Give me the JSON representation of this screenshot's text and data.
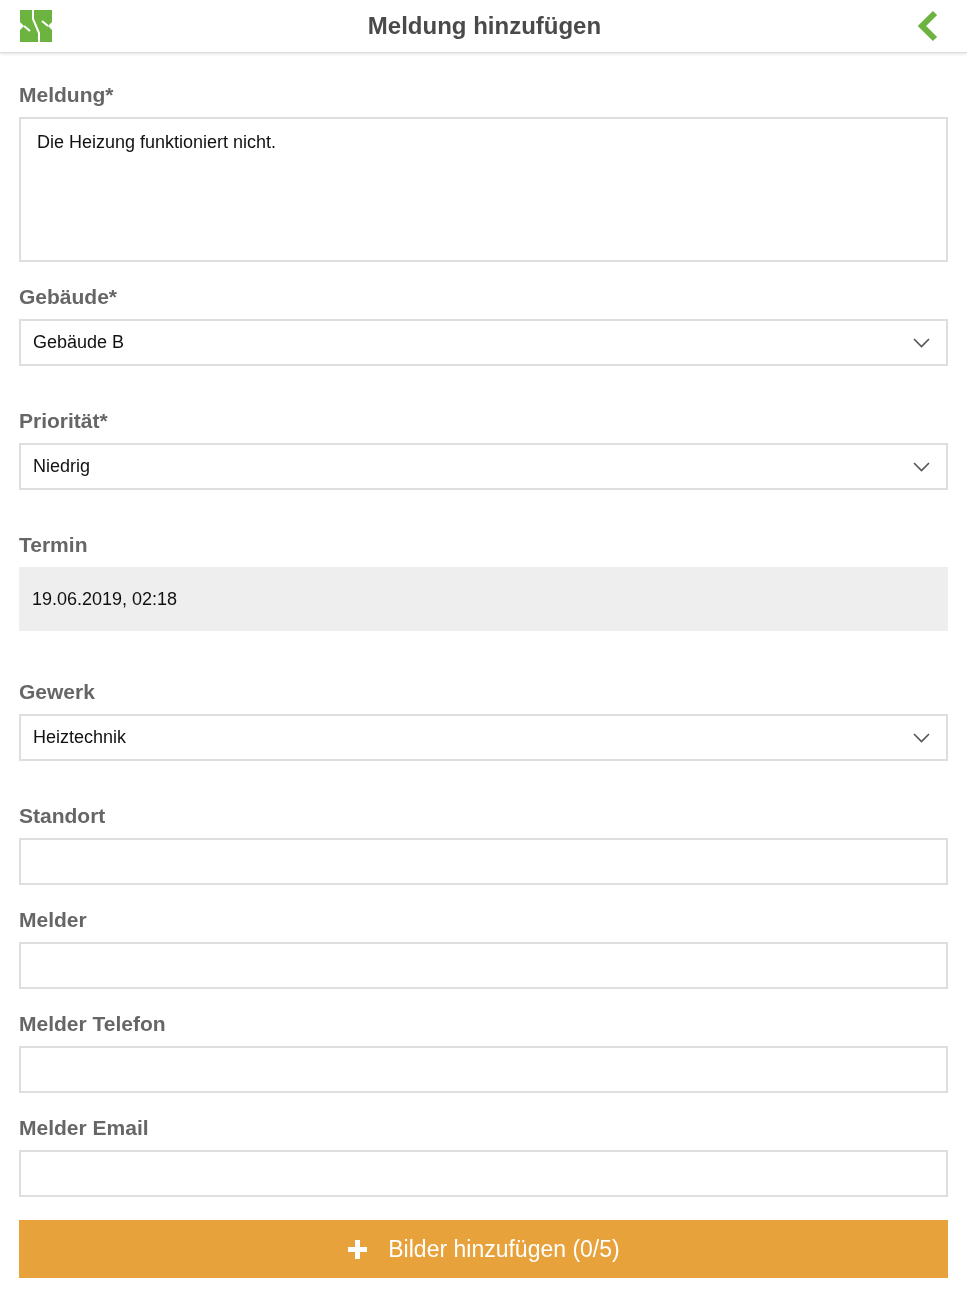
{
  "header": {
    "title": "Meldung hinzufügen"
  },
  "fields": [
    {
      "label": "Meldung*",
      "kind": "textarea",
      "value": "Die Heizung funktioniert nicht."
    },
    {
      "label": "Gebäude*",
      "kind": "select",
      "value": "Gebäude B"
    },
    {
      "label": "Priorität*",
      "kind": "select",
      "value": "Niedrig"
    },
    {
      "label": "Termin",
      "kind": "readonly",
      "value": "19.06.2019, 02:18"
    },
    {
      "label": "Gewerk",
      "kind": "select",
      "value": "Heiztechnik"
    },
    {
      "label": "Standort",
      "kind": "text"
    },
    {
      "label": "Melder",
      "kind": "text"
    },
    {
      "label": "Melder Telefon",
      "kind": "text"
    },
    {
      "label": "Melder Email",
      "kind": "text"
    }
  ],
  "button": {
    "label": "Bilder hinzufügen (0/5)"
  }
}
